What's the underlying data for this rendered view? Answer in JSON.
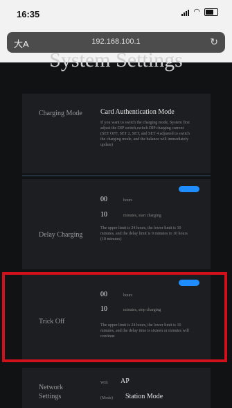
{
  "status": {
    "time": "16:35"
  },
  "browser": {
    "aa": "大A",
    "url": "192.168.100.1"
  },
  "page": {
    "title": "System Settings"
  },
  "settings": {
    "charging_mode": {
      "label": "Charging Mode",
      "value": "Card Authentication Mode",
      "description": "If you want to switch the charging mode, System first adjust the DIP switch,switch DIP charging current (SET OFF, SET 2, SET, and SET 4 adjusted to switch the charging mode, and the balance will immediately update)"
    },
    "delay_charging": {
      "label": "Delay Charging",
      "value_1": "00",
      "unit_1": "hours",
      "value_2": "10",
      "unit_2": "minutes, start charging",
      "note": "The upper limit is 24 hours, the lower limit is 10 minutes, and the delay limit is 9 minutes to 10 hours (10 minutes)"
    },
    "trickle_off": {
      "label": "Trick Off",
      "value_1": "00",
      "unit_1": "hours",
      "value_2": "10",
      "unit_2": "minutes, stop charging",
      "note": "The upper limit is 24 hours, the lower limit is 10 minutes, and the delay time is sixteen or minutes will continue"
    },
    "network_settings": {
      "label_line1": "Network",
      "label_line2": "Settings",
      "row1_key": "Wifi",
      "row1_value": "AP",
      "row2_key": "(Mode)",
      "row2_value": "Station Mode"
    }
  }
}
